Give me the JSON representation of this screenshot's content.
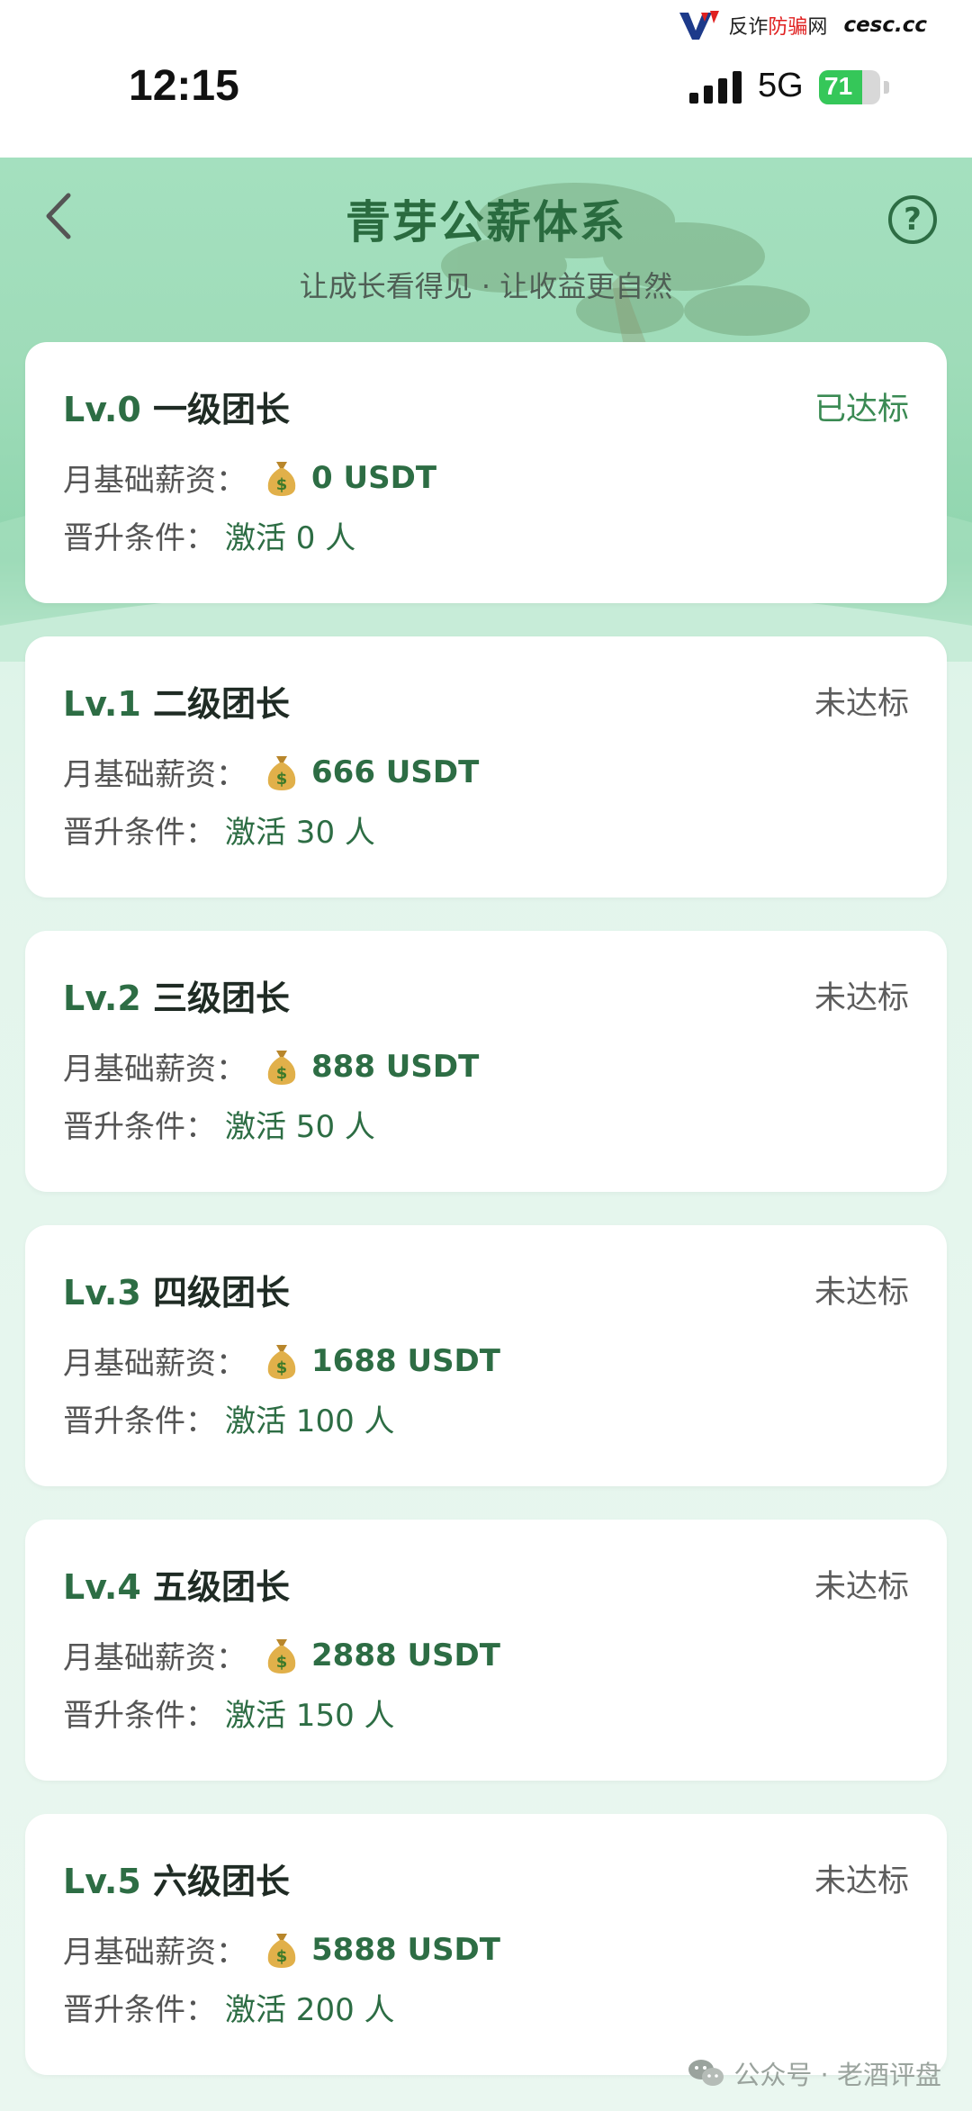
{
  "watermark_top": {
    "prefix": "反诈",
    "highlight": "防骗",
    "suffix": "网",
    "site": "cesc.cc"
  },
  "status_bar": {
    "time": "12:15",
    "network": "5G",
    "battery": "71",
    "battery_level": 0.71
  },
  "header": {
    "title": "青芽公薪体系",
    "subtitle": "让成长看得见 · 让收益更自然"
  },
  "labels": {
    "salary": "月基础薪资：",
    "condition": "晋升条件："
  },
  "levels": [
    {
      "lv": "Lv.0",
      "name": "一级团长",
      "status": "已达标",
      "salary": "0 USDT",
      "condition": "激活 0 人"
    },
    {
      "lv": "Lv.1",
      "name": "二级团长",
      "status": "未达标",
      "salary": "666 USDT",
      "condition": "激活 30 人"
    },
    {
      "lv": "Lv.2",
      "name": "三级团长",
      "status": "未达标",
      "salary": "888 USDT",
      "condition": "激活 50 人"
    },
    {
      "lv": "Lv.3",
      "name": "四级团长",
      "status": "未达标",
      "salary": "1688 USDT",
      "condition": "激活 100 人"
    },
    {
      "lv": "Lv.4",
      "name": "五级团长",
      "status": "未达标",
      "salary": "2888 USDT",
      "condition": "激活 150 人"
    },
    {
      "lv": "Lv.5",
      "name": "六级团长",
      "status": "未达标",
      "salary": "5888 USDT",
      "condition": "激活 200 人"
    }
  ],
  "watermark_bottom": "公众号 · 老酒评盘",
  "icons": {
    "back": "chevron-left-icon",
    "help": "question-circle-icon",
    "money": "money-bag-icon",
    "wechat": "wechat-icon"
  },
  "colors": {
    "accent": "#2d6d44",
    "header_bg": "#a4e0bf",
    "reached": "#3a8a53"
  }
}
